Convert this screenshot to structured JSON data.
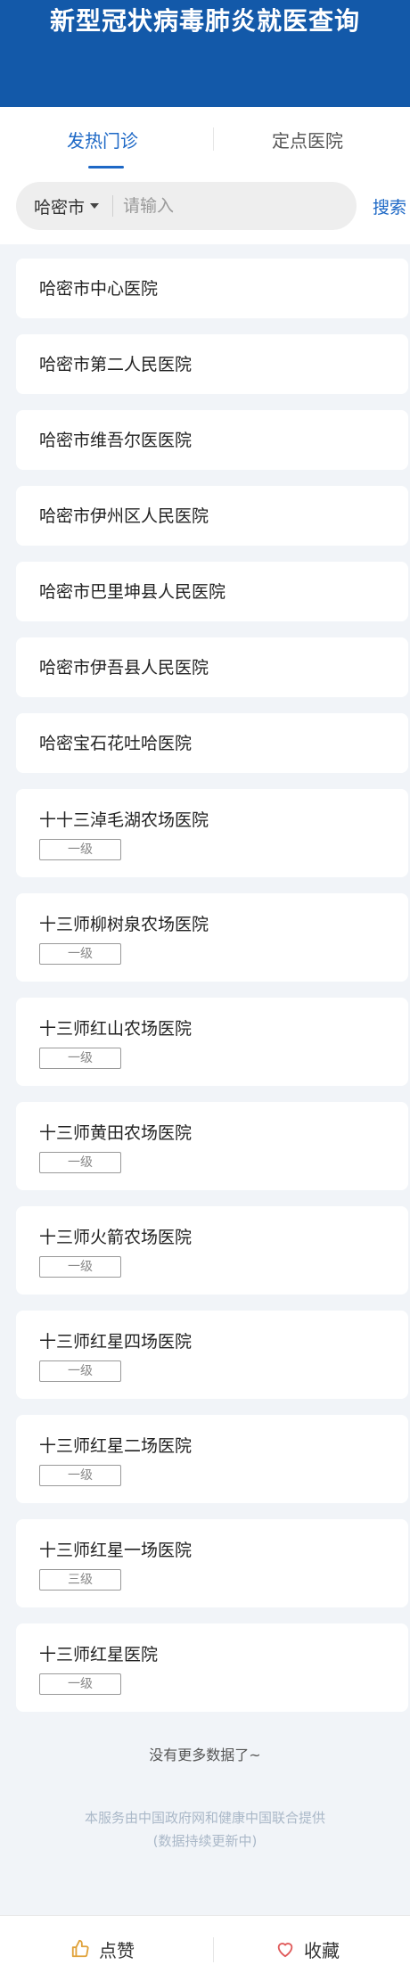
{
  "header": {
    "title": "新型冠状病毒肺炎就医查询"
  },
  "tabs": [
    {
      "label": "发热门诊",
      "active": true
    },
    {
      "label": "定点医院",
      "active": false
    }
  ],
  "search": {
    "city": "哈密市",
    "placeholder": "请输入",
    "button_label": "搜索"
  },
  "hospitals": [
    {
      "name": "哈密市中心医院",
      "level": ""
    },
    {
      "name": "哈密市第二人民医院",
      "level": ""
    },
    {
      "name": "哈密市维吾尔医医院",
      "level": ""
    },
    {
      "name": "哈密市伊州区人民医院",
      "level": ""
    },
    {
      "name": "哈密市巴里坤县人民医院",
      "level": ""
    },
    {
      "name": "哈密市伊吾县人民医院",
      "level": ""
    },
    {
      "name": "哈密宝石花吐哈医院",
      "level": ""
    },
    {
      "name": "十十三淖毛湖农场医院",
      "level": "一级"
    },
    {
      "name": "十三师柳树泉农场医院",
      "level": "一级"
    },
    {
      "name": "十三师红山农场医院",
      "level": "一级"
    },
    {
      "name": "十三师黄田农场医院",
      "level": "一级"
    },
    {
      "name": "十三师火箭农场医院",
      "level": "一级"
    },
    {
      "name": "十三师红星四场医院",
      "level": "一级"
    },
    {
      "name": "十三师红星二场医院",
      "level": "一级"
    },
    {
      "name": "十三师红星一场医院",
      "level": "三级"
    },
    {
      "name": "十三师红星医院",
      "level": "一级"
    }
  ],
  "no_more": "没有更多数据了~",
  "footer": {
    "line1": "本服务由中国政府网和健康中国联合提供",
    "line2": "(数据持续更新中)"
  },
  "bottom_bar": {
    "like_label": "点赞",
    "favorite_label": "收藏"
  },
  "colors": {
    "header_bg": "#1359a9",
    "accent": "#1d68c6",
    "page_bg": "#f1f4f8"
  },
  "icons": {
    "like": "thumbs-up-icon",
    "favorite": "heart-icon",
    "city_dropdown": "caret-down-icon"
  }
}
